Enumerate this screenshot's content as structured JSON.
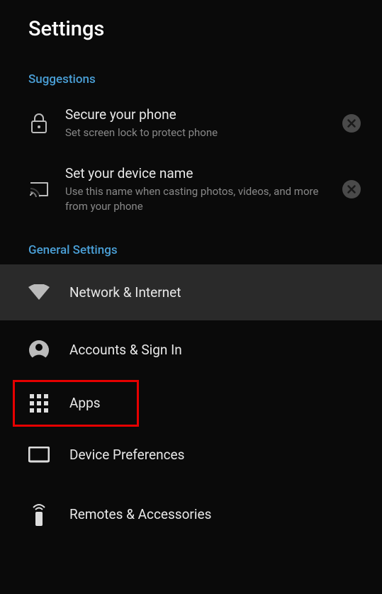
{
  "header": {
    "title": "Settings"
  },
  "sections": {
    "suggestions": {
      "label": "Suggestions",
      "items": [
        {
          "title": "Secure your phone",
          "subtitle": "Set screen lock to protect phone"
        },
        {
          "title": "Set your device name",
          "subtitle": "Use this name when casting photos, videos, and more from your phone"
        }
      ]
    },
    "general": {
      "label": "General Settings",
      "items": [
        {
          "label": "Network & Internet"
        },
        {
          "label": "Accounts & Sign In"
        },
        {
          "label": "Apps"
        },
        {
          "label": "Device Preferences"
        },
        {
          "label": "Remotes & Accessories"
        }
      ]
    }
  }
}
